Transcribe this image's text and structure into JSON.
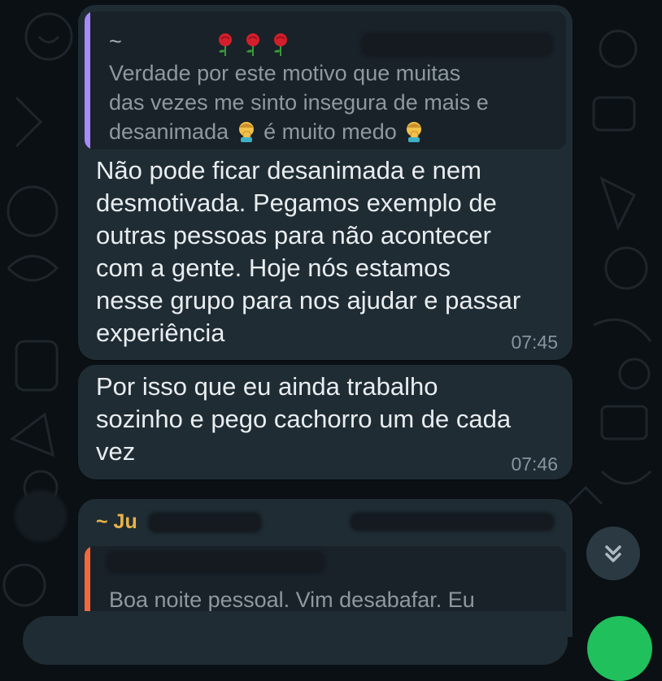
{
  "quoted_reply": {
    "author": "~",
    "author_emoji": "rose",
    "text_line1": "Verdade por este motivo que muitas",
    "text_line2": "das vezes me sinto insegura de mais e",
    "text_line3_a": "desanimada",
    "text_line3_b": "é muito medo",
    "bar_color": "#a78bfa"
  },
  "message1": {
    "lines": [
      "Não pode ficar desanimada e nem",
      "desmotivada. Pegamos exemplo de",
      "outras pessoas para não acontecer",
      "com a gente. Hoje nós estamos",
      "nesse grupo para nos ajudar e passar",
      "experiência"
    ],
    "time": "07:45"
  },
  "message2": {
    "lines": [
      "Por isso que eu ainda trabalho",
      "sozinho e pego cachorro um de cada",
      "vez"
    ],
    "time": "07:46"
  },
  "message3": {
    "sender": "~ Ju",
    "quote_text": "Boa noite pessoal. Vim desabafar. Eu",
    "quote_bar_color": "#f26a3d"
  },
  "icons": {
    "scroll": "chevrons-down-icon"
  }
}
